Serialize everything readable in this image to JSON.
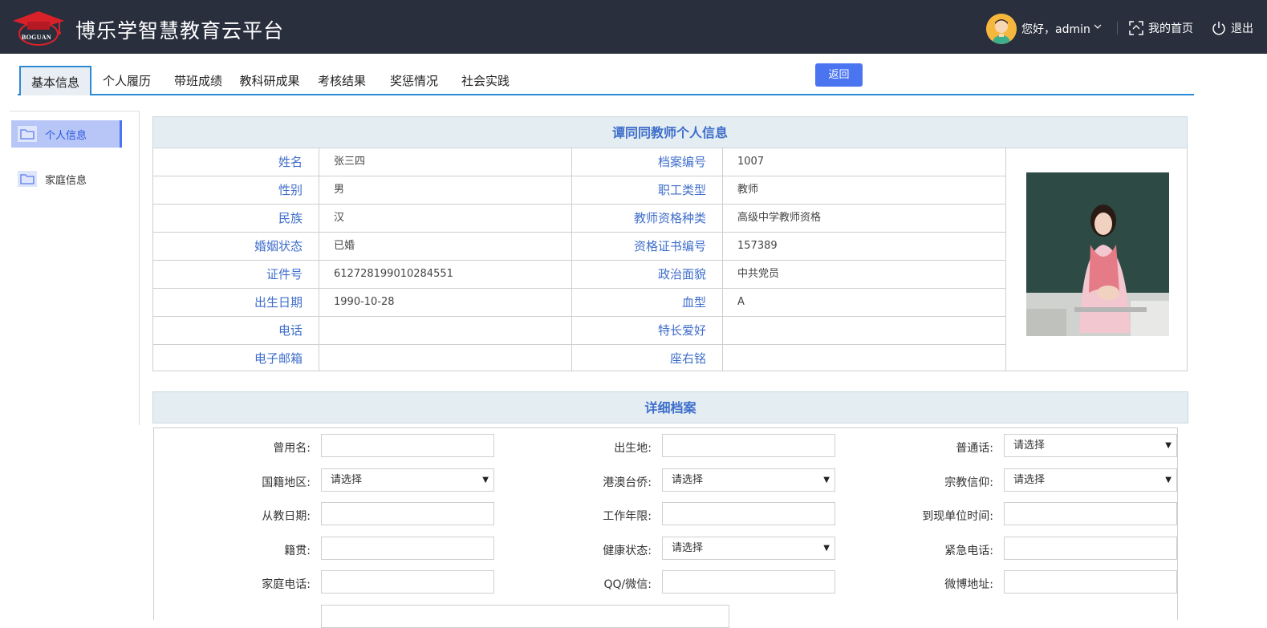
{
  "header": {
    "app_title": "博乐学智慧教育云平台",
    "logo_text": "BOGUAN",
    "greeting": "您好，admin",
    "home_label": "我的首页",
    "logout_label": "退出"
  },
  "tabs": [
    {
      "label": "基本信息",
      "active": true
    },
    {
      "label": "个人履历"
    },
    {
      "label": "带班成绩"
    },
    {
      "label": "教科研成果"
    },
    {
      "label": "考核结果"
    },
    {
      "label": "奖惩情况"
    },
    {
      "label": "社会实践"
    }
  ],
  "back_button": "返回",
  "sidebar": {
    "items": [
      {
        "label": "个人信息",
        "active": true
      },
      {
        "label": "家庭信息"
      }
    ]
  },
  "info_panel": {
    "title": "谭同同教师个人信息",
    "rows": [
      {
        "l1": "姓名",
        "v1": "张三四",
        "l2": "档案编号",
        "v2": "1007"
      },
      {
        "l1": "性别",
        "v1": "男",
        "l2": "职工类型",
        "v2": "教师"
      },
      {
        "l1": "民族",
        "v1": "汉",
        "l2": "教师资格种类",
        "v2": "高级中学教师资格"
      },
      {
        "l1": "婚姻状态",
        "v1": "已婚",
        "l2": "资格证书编号",
        "v2": "157389"
      },
      {
        "l1": "证件号",
        "v1": "612728199010284551",
        "l2": "政治面貌",
        "v2": "中共党员"
      },
      {
        "l1": "出生日期",
        "v1": "1990-10-28",
        "l2": "血型",
        "v2": "A"
      },
      {
        "l1": "电话",
        "v1": "",
        "l2": "特长爱好",
        "v2": ""
      },
      {
        "l1": "电子邮箱",
        "v1": "",
        "l2": "座右铭",
        "v2": ""
      }
    ]
  },
  "detail_panel": {
    "title": "详细档案",
    "select_placeholder": "请选择",
    "fields": [
      {
        "label": "曾用名:",
        "type": "text",
        "value": ""
      },
      {
        "label": "出生地:",
        "type": "text",
        "value": ""
      },
      {
        "label": "普通话:",
        "type": "select",
        "value": "请选择"
      },
      {
        "label": "国籍地区:",
        "type": "select",
        "value": "请选择"
      },
      {
        "label": "港澳台侨:",
        "type": "select",
        "value": "请选择"
      },
      {
        "label": "宗教信仰:",
        "type": "select",
        "value": "请选择"
      },
      {
        "label": "从教日期:",
        "type": "text",
        "value": ""
      },
      {
        "label": "工作年限:",
        "type": "text",
        "value": ""
      },
      {
        "label": "到现单位时间:",
        "type": "text",
        "value": ""
      },
      {
        "label": "籍贯:",
        "type": "text",
        "value": ""
      },
      {
        "label": "健康状态:",
        "type": "select",
        "value": "请选择"
      },
      {
        "label": "紧急电话:",
        "type": "text",
        "value": ""
      },
      {
        "label": "家庭电话:",
        "type": "text",
        "value": ""
      },
      {
        "label": "QQ/微信:",
        "type": "text",
        "value": ""
      },
      {
        "label": "微博地址:",
        "type": "text",
        "value": ""
      }
    ]
  },
  "colors": {
    "topbar": "#2a2f3d",
    "accent_blue": "#4a74f0",
    "label_blue": "#3f6ecb",
    "tab_line": "#2b8ad6"
  }
}
